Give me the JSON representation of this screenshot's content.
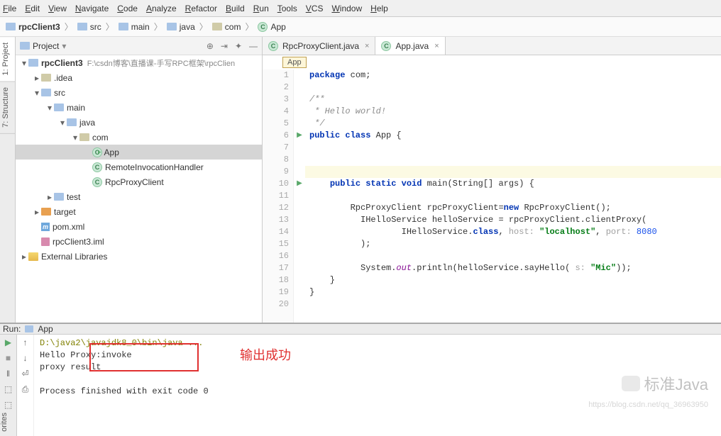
{
  "menubar": [
    "File",
    "Edit",
    "View",
    "Navigate",
    "Code",
    "Analyze",
    "Refactor",
    "Build",
    "Run",
    "Tools",
    "VCS",
    "Window",
    "Help"
  ],
  "nav": {
    "crumbs": [
      {
        "icon": "proj",
        "label": "rpcClient3",
        "bold": true
      },
      {
        "icon": "folder-blue",
        "label": "src"
      },
      {
        "icon": "folder-blue",
        "label": "main"
      },
      {
        "icon": "folder-blue",
        "label": "java"
      },
      {
        "icon": "folder",
        "label": "com"
      },
      {
        "icon": "class",
        "label": "App"
      }
    ]
  },
  "project": {
    "title": "Project",
    "tree": [
      {
        "d": 0,
        "a": "open",
        "icon": "proj",
        "label": "rpcClient3",
        "bold": true,
        "path": "F:\\csdn博客\\直播课-手写RPC框架\\rpcClien"
      },
      {
        "d": 1,
        "a": "closed",
        "icon": "folder",
        "label": ".idea"
      },
      {
        "d": 1,
        "a": "open",
        "icon": "folder-blue",
        "label": "src"
      },
      {
        "d": 2,
        "a": "open",
        "icon": "folder-blue",
        "label": "main"
      },
      {
        "d": 3,
        "a": "open",
        "icon": "folder-blue",
        "label": "java"
      },
      {
        "d": 4,
        "a": "open",
        "icon": "folder",
        "label": "com"
      },
      {
        "d": 5,
        "a": "none",
        "icon": "class",
        "label": "App",
        "sel": true,
        "arrowmark": true
      },
      {
        "d": 5,
        "a": "none",
        "icon": "class",
        "label": "RemoteInvocationHandler"
      },
      {
        "d": 5,
        "a": "none",
        "icon": "class",
        "label": "RpcProxyClient"
      },
      {
        "d": 2,
        "a": "closed",
        "icon": "folder-blue",
        "label": "test"
      },
      {
        "d": 1,
        "a": "closed",
        "icon": "folder-orange",
        "label": "target"
      },
      {
        "d": 1,
        "a": "none",
        "icon": "maven",
        "label": "pom.xml"
      },
      {
        "d": 1,
        "a": "none",
        "icon": "iml",
        "label": "rpcClient3.iml"
      },
      {
        "d": 0,
        "a": "closed",
        "icon": "ext",
        "label": "External Libraries"
      }
    ]
  },
  "sidebar": {
    "project": "1: Project",
    "structure": "7: Structure"
  },
  "editor": {
    "tabs": [
      {
        "label": "RpcProxyClient.java",
        "active": false
      },
      {
        "label": "App.java",
        "active": true
      }
    ],
    "breadcrumb": "App",
    "code": [
      {
        "n": 1,
        "html": "<span class='kw'>package</span> com;"
      },
      {
        "n": 2,
        "html": ""
      },
      {
        "n": 3,
        "html": "<span class='cmt'>/**</span>"
      },
      {
        "n": 4,
        "html": "<span class='cmt'> * Hello world!</span>"
      },
      {
        "n": 5,
        "html": "<span class='cmt'> */</span>"
      },
      {
        "n": 6,
        "html": "<span class='kw'>public class</span> App {",
        "run": true
      },
      {
        "n": 7,
        "html": ""
      },
      {
        "n": 8,
        "html": ""
      },
      {
        "n": 9,
        "html": "",
        "hl": true
      },
      {
        "n": 10,
        "html": "    <span class='kw'>public static void</span> main(String[] args) {",
        "run": true
      },
      {
        "n": 11,
        "html": ""
      },
      {
        "n": 12,
        "html": "        RpcProxyClient rpcProxyClient=<span class='kw'>new</span> RpcProxyClient();"
      },
      {
        "n": 13,
        "html": "          IHelloService helloService = rpcProxyClient.clientProxy("
      },
      {
        "n": 14,
        "html": "                  IHelloService.<span class='kw'>class</span>, <span class='hint'>host:</span> <span class='str'>\"localhost\"</span>, <span class='hint'>port:</span> <span class='num'>8080</span>"
      },
      {
        "n": 15,
        "html": "          );"
      },
      {
        "n": 16,
        "html": ""
      },
      {
        "n": 17,
        "html": "          System.<span class='static-ref'>out</span>.println(helloService.sayHello( <span class='hint'>s:</span> <span class='str'>\"Mic\"</span>));"
      },
      {
        "n": 18,
        "html": "    }"
      },
      {
        "n": 19,
        "html": "}"
      },
      {
        "n": 20,
        "html": ""
      }
    ]
  },
  "run": {
    "header_prefix": "Run:",
    "header_app": "App",
    "lines": [
      {
        "cls": "cmd-text",
        "text": "D:\\java2\\javajdk8_0\\bin\\java ..."
      },
      {
        "text": "Hello Proxy:invoke"
      },
      {
        "text": "proxy result"
      },
      {
        "text": ""
      },
      {
        "text": "Process finished with exit code 0"
      }
    ],
    "annotation": "输出成功",
    "favorites": "orites"
  },
  "watermark": {
    "text": "标准Java",
    "url": "https://blog.csdn.net/qq_36963950"
  }
}
